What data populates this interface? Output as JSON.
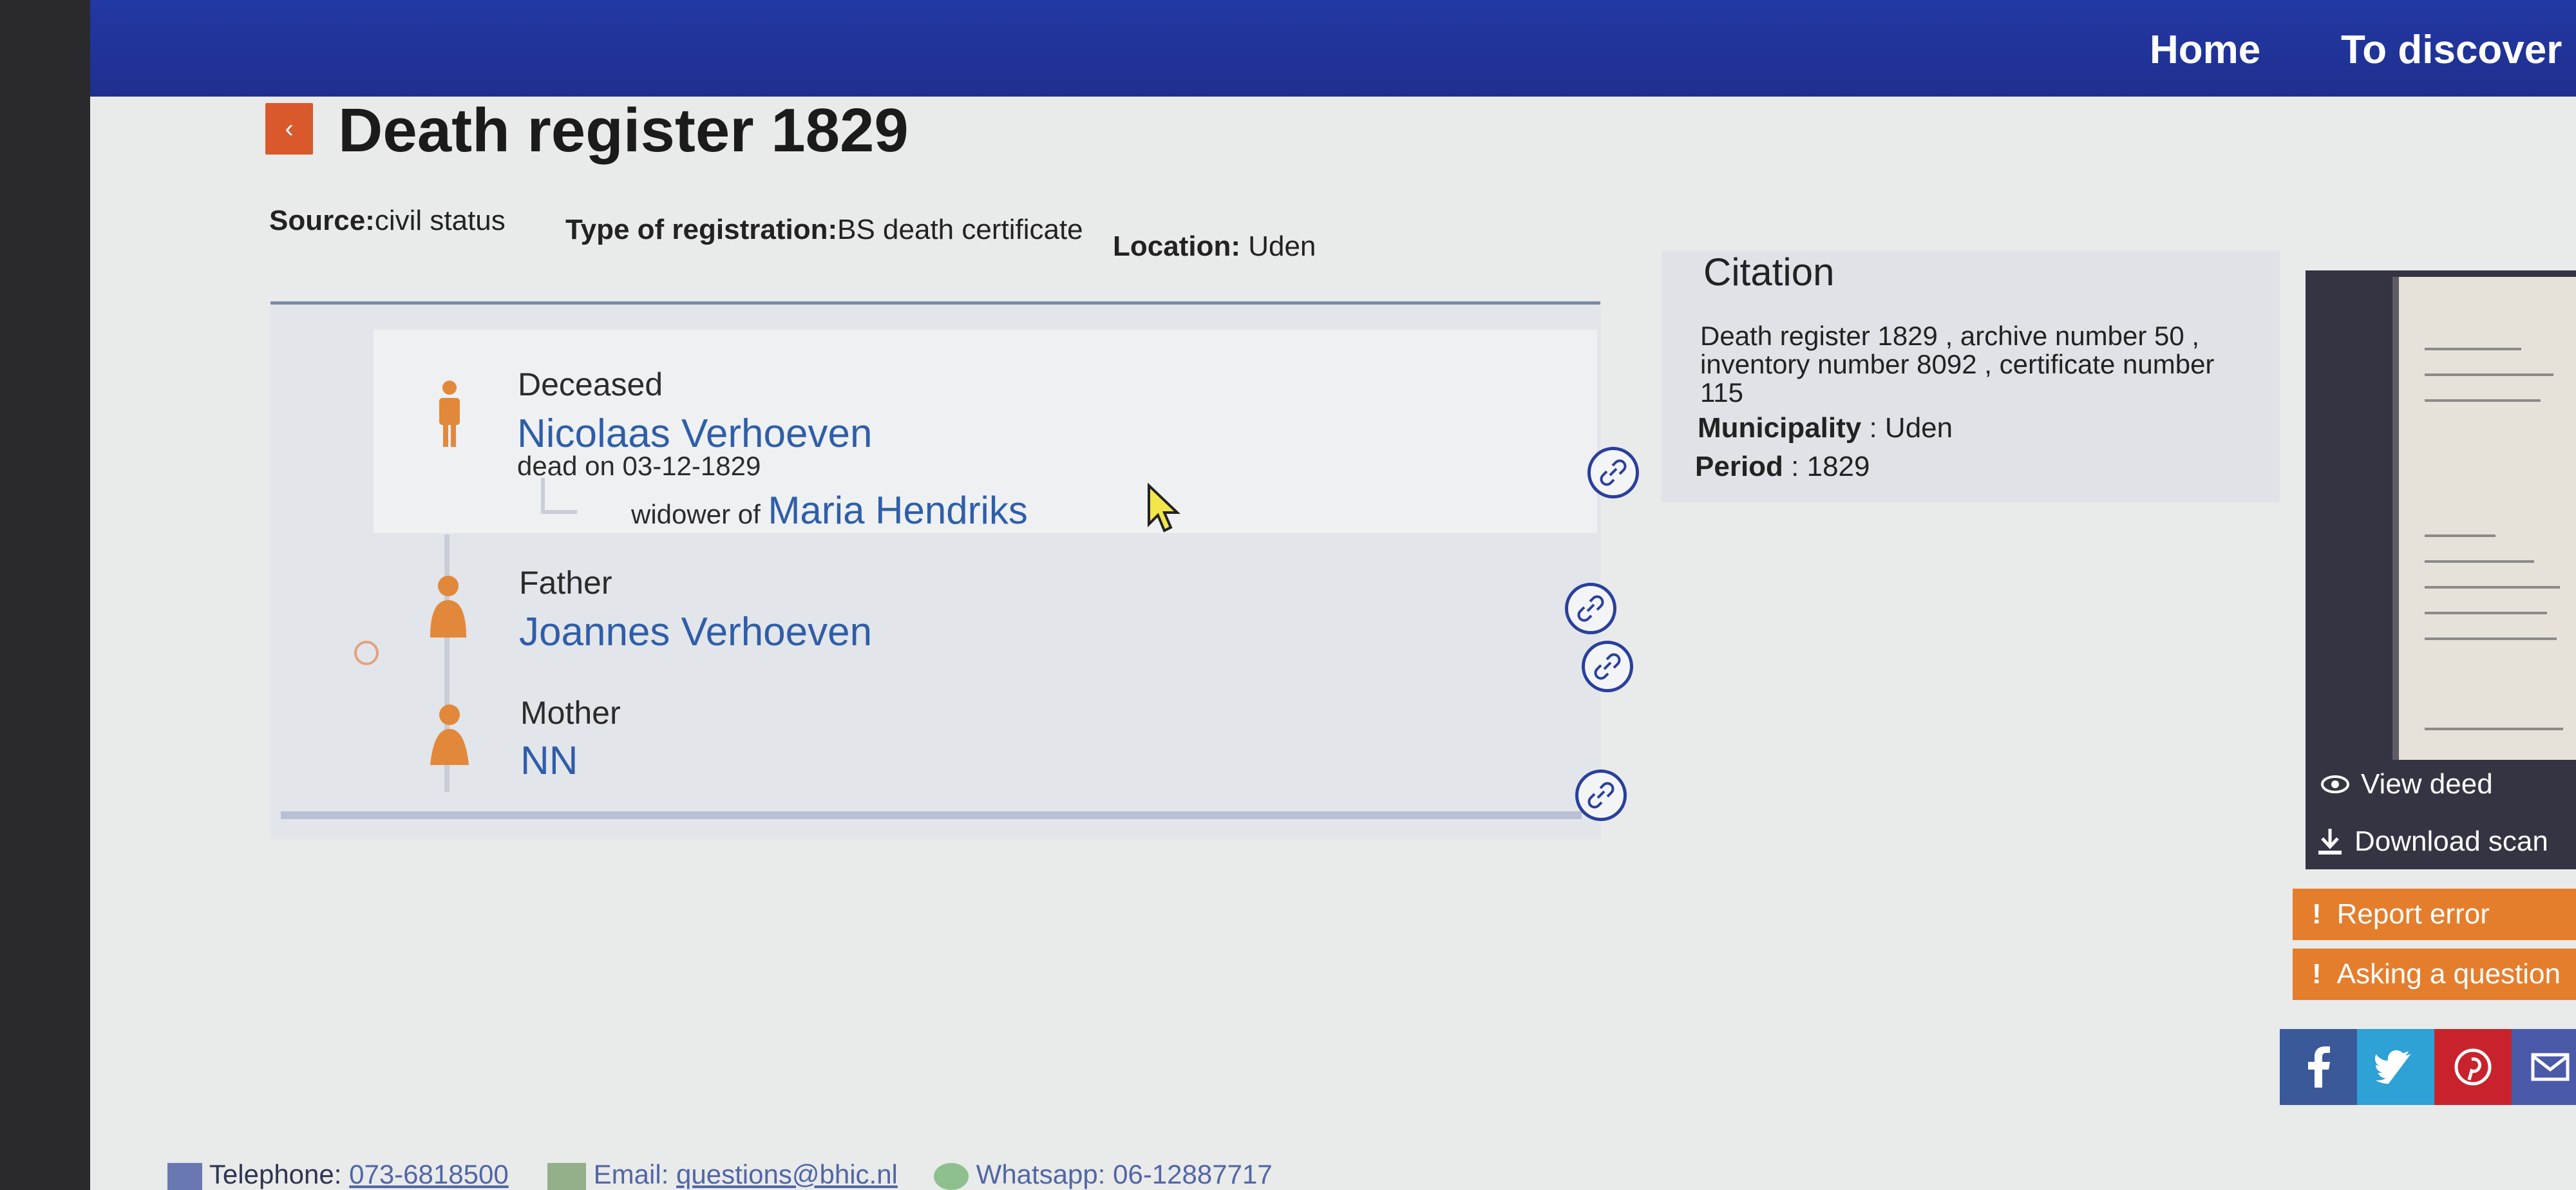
{
  "nav": {
    "home": "Home",
    "discover": "To discover"
  },
  "page": {
    "back_icon": "chevron-left-icon",
    "title": "Death register 1829"
  },
  "meta": {
    "source_label": "Source:",
    "source_value": "civil status",
    "type_label": "Type of registration:",
    "type_value": "BS death certificate",
    "location_label": "Location:",
    "location_value": "Uden"
  },
  "persons": {
    "deceased": {
      "role": "Deceased",
      "name": "Nicolaas Verhoeven",
      "detail": "dead on 03-12-1829",
      "relation_label": "widower of",
      "relation_name": "Maria Hendriks"
    },
    "father": {
      "role": "Father",
      "name": "Joannes Verhoeven"
    },
    "mother": {
      "role": "Mother",
      "name": "NN"
    }
  },
  "citation": {
    "title": "Citation",
    "text": "Death register 1829 , archive number 50 , inventory number 8092 , certificate number 115",
    "municipality_label": "Municipality",
    "municipality_value": ": Uden",
    "period_label": "Period",
    "period_value": ": 1829"
  },
  "scan": {
    "view_deed": "View deed",
    "download_scan": "Download scan"
  },
  "actions": {
    "report_error": "Report error",
    "ask_question": "Asking a question",
    "exclamation": "!"
  },
  "footer": {
    "telephone_label": "Telephone:",
    "telephone_value": "073-6818500",
    "email_label": "Email:",
    "email_value": "questions@bhic.nl",
    "whatsapp_label": "Whatsapp:",
    "whatsapp_value": "06-12887717"
  },
  "colors": {
    "nav": "#2238a3",
    "accent": "#e57e2c",
    "link": "#2f5ea8",
    "facebook": "#3b5998",
    "twitter": "#2ea1d6",
    "pinterest": "#c8232c"
  }
}
